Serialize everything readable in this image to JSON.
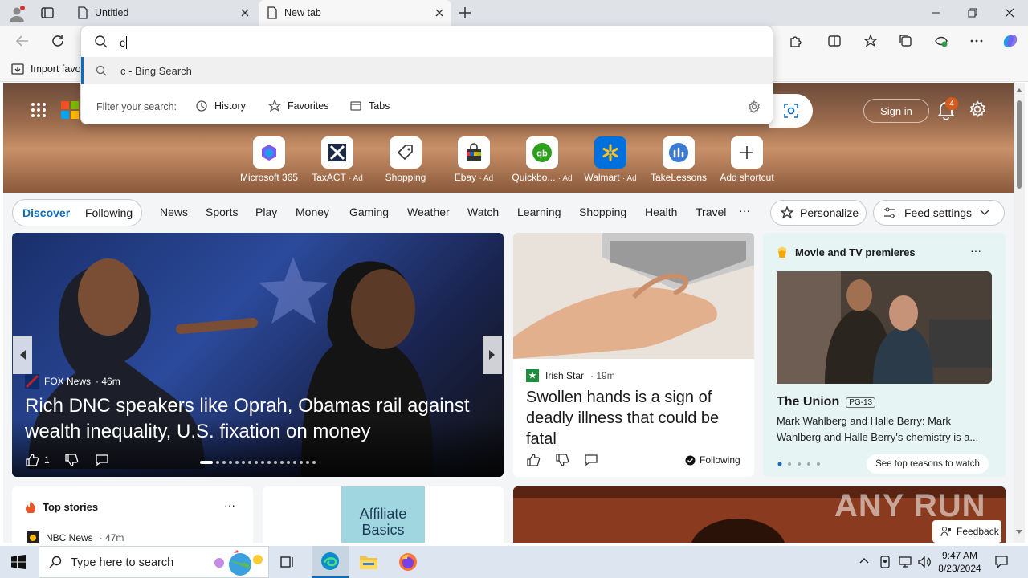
{
  "tabs": [
    {
      "title": "Untitled"
    },
    {
      "title": "New tab"
    }
  ],
  "address": {
    "value": "c",
    "suggestion": "c - Bing Search",
    "filter_label": "Filter your search:",
    "filters": [
      "History",
      "Favorites",
      "Tabs"
    ]
  },
  "favbar": {
    "import_label": "Import favo"
  },
  "header": {
    "sign_in": "Sign in",
    "notif_count": "4"
  },
  "shortcuts": [
    {
      "label": "Microsoft 365",
      "ad": ""
    },
    {
      "label": "TaxACT",
      "ad": "· Ad"
    },
    {
      "label": "Shopping",
      "ad": ""
    },
    {
      "label": "Ebay",
      "ad": "· Ad"
    },
    {
      "label": "Quickbo...",
      "ad": "· Ad"
    },
    {
      "label": "Walmart",
      "ad": "· Ad"
    },
    {
      "label": "TakeLessons",
      "ad": ""
    },
    {
      "label": "Add shortcut",
      "ad": ""
    }
  ],
  "feed_nav": {
    "discover": "Discover",
    "following": "Following",
    "items": [
      "News",
      "Sports",
      "Play",
      "Money",
      "Gaming",
      "Weather",
      "Watch",
      "Learning",
      "Shopping",
      "Health",
      "Travel"
    ],
    "more": "···",
    "personalize": "Personalize",
    "feed_settings": "Feed settings"
  },
  "hero_card": {
    "source": "FOX News",
    "age": "· 46m",
    "headline": "Rich DNC speakers like Oprah, Obamas rail against wealth inequality, U.S. fixation on money",
    "likes": "1"
  },
  "mid_card": {
    "source": "Irish Star",
    "age": "· 19m",
    "headline": "Swollen hands is a sign of deadly illness that could be fatal",
    "following": "Following"
  },
  "movie_card": {
    "section": "Movie and TV premieres",
    "title": "The Union",
    "rating": "PG-13",
    "desc": "Mark Wahlberg and Halle Berry: Mark Wahlberg and Halle Berry's chemistry is a...",
    "cta": "See top reasons to watch"
  },
  "top_stories": {
    "title": "Top stories",
    "first_source": "NBC News",
    "first_age": "· 47m"
  },
  "ad_card": {
    "text": "Affiliate Basics"
  },
  "feedback": "Feedback",
  "watermark": "ANY RUN",
  "taskbar": {
    "search_placeholder": "Type here to search",
    "time": "9:47 AM",
    "date": "8/23/2024"
  },
  "colors": {
    "accent": "#0f6cbd",
    "notif_badge": "#d65a1e"
  }
}
